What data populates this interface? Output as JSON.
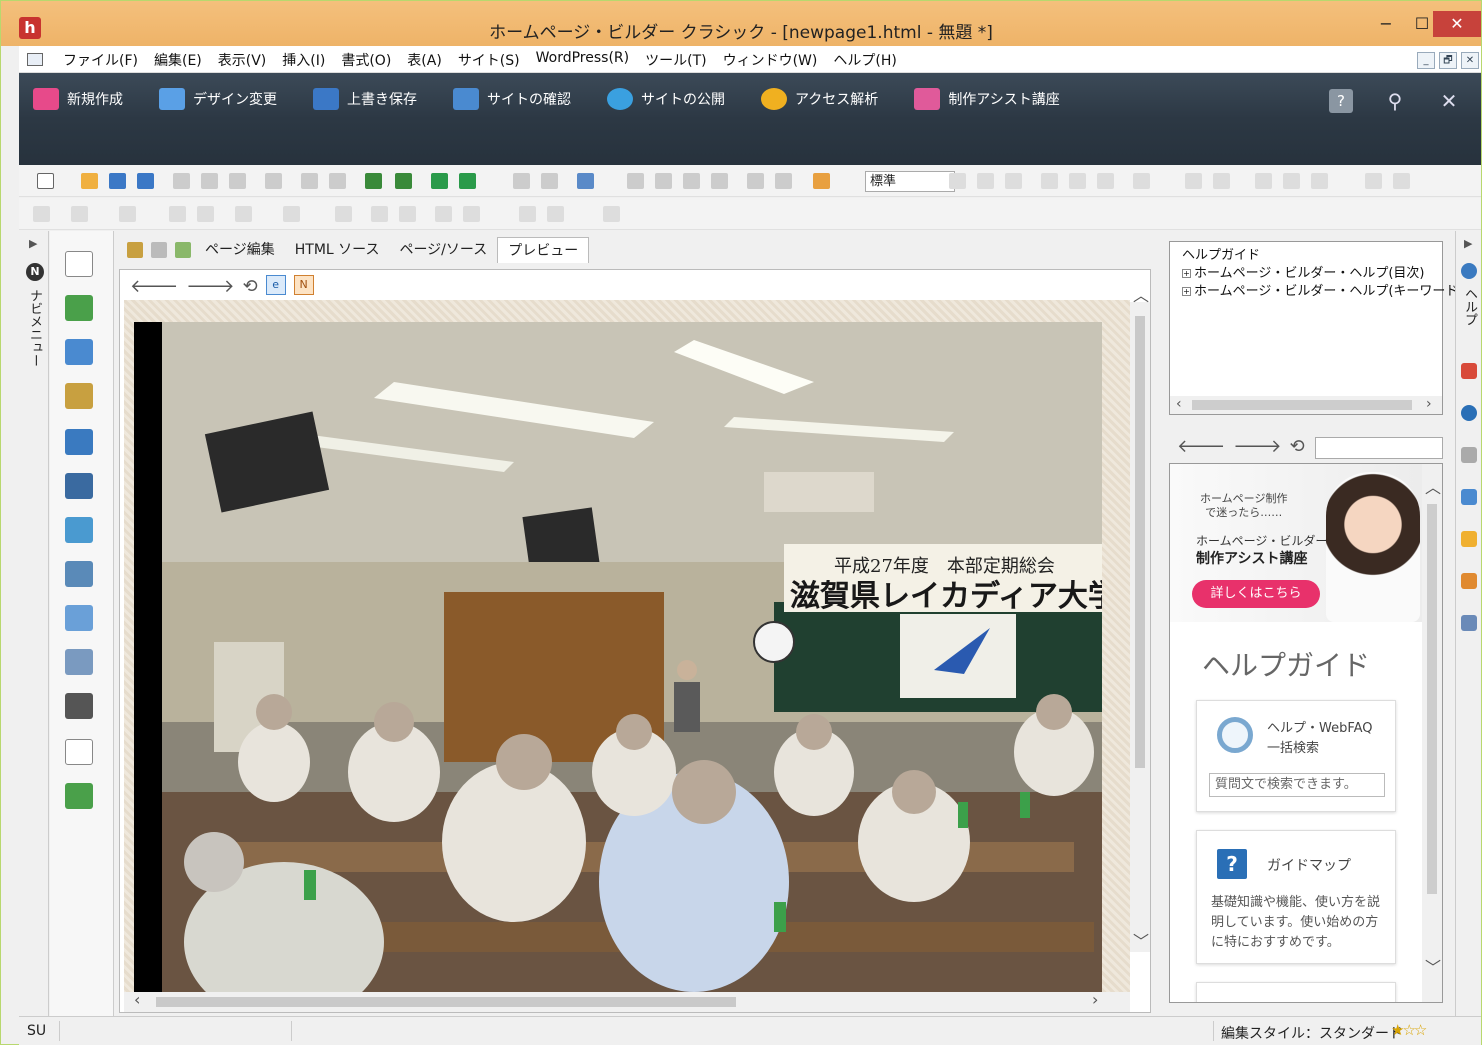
{
  "window": {
    "app_logo": "h",
    "title": "ホームページ・ビルダー クラシック - [newpage1.html - 無題 *]",
    "min": "−",
    "max": "☐",
    "close": "✕"
  },
  "menu": {
    "items": [
      "ファイル(F)",
      "編集(E)",
      "表示(V)",
      "挿入(I)",
      "書式(O)",
      "表(A)",
      "サイト(S)",
      "WordPress(R)",
      "ツール(T)",
      "ウィンドウ(W)",
      "ヘルプ(H)"
    ],
    "mdi": [
      "_",
      "🗗",
      "✕"
    ]
  },
  "dark_toolbar": {
    "buttons": [
      {
        "label": "新規作成",
        "color": "#e74a8a"
      },
      {
        "label": "デザイン変更",
        "color": "#5aa0e6"
      },
      {
        "label": "上書き保存",
        "color": "#3b78c6"
      },
      {
        "label": "サイトの確認",
        "color": "#4a8ad0"
      },
      {
        "label": "サイトの公開",
        "color": "#3aa0e0"
      },
      {
        "label": "アクセス解析",
        "color": "#f0b020"
      },
      {
        "label": "制作アシスト講座",
        "color": "#e05a9a"
      }
    ],
    "right": [
      "?",
      "⚲",
      "✕"
    ]
  },
  "toolbar": {
    "style_value": "標準"
  },
  "nav": {
    "badge": "N",
    "label": "ナビメニュー",
    "expand": "▶"
  },
  "editor": {
    "tabs": [
      "ページ編集",
      "HTML ソース",
      "ページ/ソース",
      "プレビュー"
    ],
    "active_tab": "プレビュー",
    "preview_nav": [
      "🡐",
      "🡒",
      "⟲"
    ],
    "mode_badges": [
      "e",
      "N"
    ],
    "photo": {
      "banner_line1": "平成27年度　本部定期総会",
      "banner_line2": "滋賀県レイカディア大学同窓"
    }
  },
  "help": {
    "tree": [
      {
        "label": "ヘルプガイド",
        "expander": ""
      },
      {
        "label": "ホームページ・ビルダー・ヘルプ(目次)",
        "expander": "+"
      },
      {
        "label": "ホームページ・ビルダー・ヘルプ(キーワード)",
        "expander": "+"
      }
    ],
    "nav": [
      "🡐",
      "🡒",
      "⟲"
    ],
    "banner": {
      "line1": "ホームページ制作\nで迷ったら……",
      "line2": "ホームページ・ビルダー",
      "line3": "制作アシスト講座",
      "button": "詳しくはこちら"
    },
    "title": "ヘルプガイド",
    "card1": {
      "title": "ヘルプ・WebFAQ\n一括検索",
      "placeholder": "質問文で検索できます。"
    },
    "card2": {
      "icon": "?",
      "title": "ガイドマップ",
      "desc": "基礎知識や機能、使い方を説明しています。使い始めの方に特におすすめです。"
    }
  },
  "right_strip": {
    "label": "ヘルプ",
    "expand": "▶"
  },
  "status": {
    "left": "SU",
    "edit_style": "編集スタイル：スタンダード",
    "stars": "★☆☆"
  }
}
